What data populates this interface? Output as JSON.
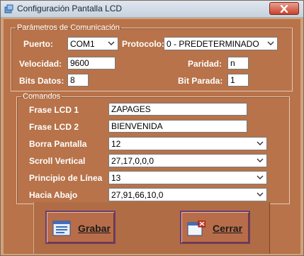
{
  "window": {
    "title": "Configuración Pantalla LCD",
    "close_icon": "close-icon"
  },
  "comm": {
    "legend": "Parámetros de Comunicación",
    "puerto_label": "Puerto:",
    "puerto_value": "COM1",
    "protocolo_label": "Protocolo:",
    "protocolo_value": "0 - PREDETERMINADO",
    "velocidad_label": "Velocidad:",
    "velocidad_value": "9600",
    "paridad_label": "Paridad:",
    "paridad_value": "n",
    "bits_datos_label": "Bits Datos:",
    "bits_datos_value": "8",
    "bit_parada_label": "Bit Parada:",
    "bit_parada_value": "1"
  },
  "commands": {
    "legend": "Comandos",
    "frase1_label": "Frase LCD 1",
    "frase1_value": "ZAPAGES",
    "frase2_label": "Frase LCD 2",
    "frase2_value": "BIENVENIDA",
    "borra_label": "Borra Pantalla",
    "borra_value": "12",
    "scroll_label": "Scroll Vertical",
    "scroll_value": "27,17,0,0,0",
    "principio_label": "Principio de Línea",
    "principio_value": "13",
    "abajo_label": "Hacia Abajo",
    "abajo_value": "27,91,66,10,0"
  },
  "buttons": {
    "save_label": "Grabar",
    "save_icon": "form-icon",
    "close_label": "Cerrar",
    "close_icon": "close-window-icon"
  }
}
